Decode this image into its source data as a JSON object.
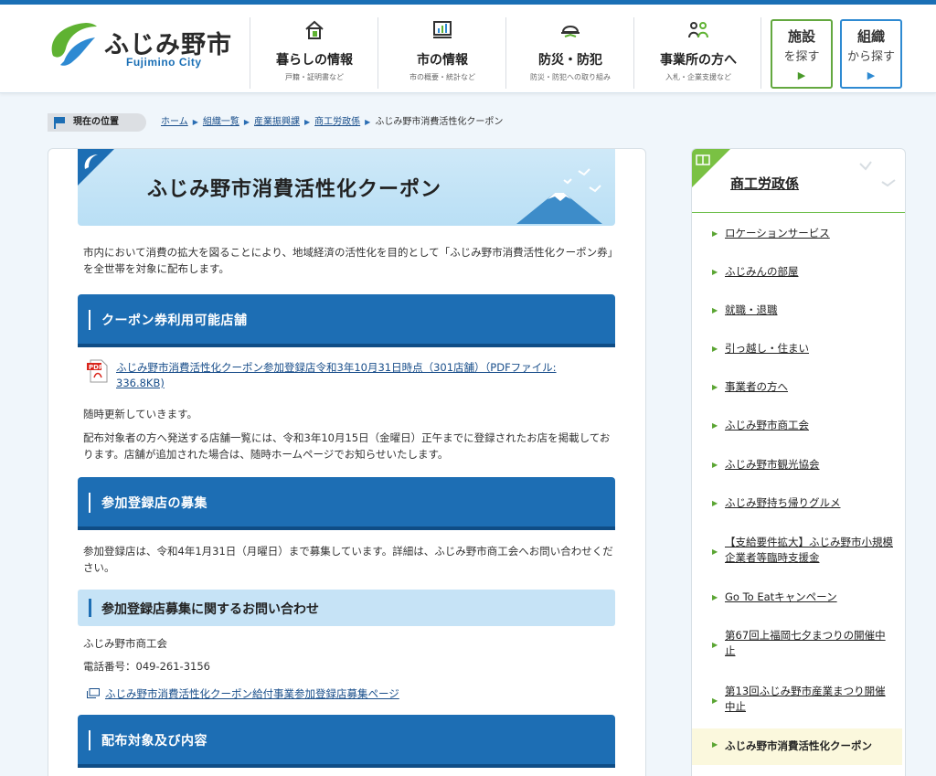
{
  "header": {
    "logo_text": "ふじみ野市",
    "logo_sub": "Fujimino City",
    "nav": [
      {
        "label": "暮らしの情報",
        "sub": "戸籍・証明書など",
        "icon": "house-icon"
      },
      {
        "label": "市の情報",
        "sub": "市の概要・統計など",
        "icon": "chart-board-icon"
      },
      {
        "label": "防災・防犯",
        "sub": "防災・防犯への取り組み",
        "icon": "helmet-icon"
      },
      {
        "label": "事業所の方へ",
        "sub": "入札・企業支援など",
        "icon": "people-icon"
      }
    ],
    "facility_btn": {
      "line1": "施設",
      "line2": "を探す",
      "arrow": "▶"
    },
    "org_btn": {
      "line1": "組織",
      "line2": "から探す",
      "arrow": "▶"
    }
  },
  "breadcrumb": {
    "label": "現在の位置",
    "items": [
      "ホーム",
      "組織一覧",
      "産業振興課",
      "商工労政係"
    ],
    "current": "ふじみ野市消費活性化クーポン",
    "sep": "▶"
  },
  "main": {
    "title": "ふじみ野市消費活性化クーポン",
    "intro": "市内において消費の拡大を図ることにより、地域経済の活性化を目的として「ふじみ野市消費活性化クーポン券」を全世帯を対象に配布します。",
    "sec1_heading": "クーポン券利用可能店舗",
    "pdf_link": "ふじみ野市消費活性化クーポン参加登録店令和3年10月31日時点（301店舗）（PDFファイル: 336.8KB)",
    "update_note": "随時更新していきます。",
    "list_note": "配布対象者の方へ発送する店舗一覧には、令和3年10月15日（金曜日）正午までに登録されたお店を掲載しております。店舗が追加された場合は、随時ホームページでお知らせいたします。",
    "sec2_heading": "参加登録店の募集",
    "recruit_text": "参加登録店は、令和4年1月31日（月曜日）まで募集しています。詳細は、ふじみ野市商工会へお問い合わせください。",
    "sec3_heading": "参加登録店募集に関するお問い合わせ",
    "contact_org": "ふじみ野市商工会",
    "contact_tel": "電話番号：049-261-3156",
    "ext_link": "ふじみ野市消費活性化クーポン給付事業参加登録店募集ページ",
    "sec4_heading": "配布対象及び内容"
  },
  "sidebar": {
    "title": "商工労政係",
    "items": [
      "ロケーションサービス",
      "ふじみんの部屋",
      "就職・退職",
      "引っ越し・住まい",
      "事業者の方へ",
      "ふじみ野市商工会",
      "ふじみ野市観光協会",
      "ふじみ野持ち帰りグルメ",
      "【支給要件拡大】ふじみ野市小規模企業者等臨時支援金",
      "Go To Eatキャンペーン",
      "第67回上福岡七夕まつりの開催中止",
      "第13回ふじみ野市産業まつり開催中止"
    ],
    "active": "ふじみ野市消費活性化クーポン"
  },
  "colors": {
    "brand_blue": "#1d6eb4",
    "brand_green": "#63a83f",
    "heading_light": "#c6e3f6"
  }
}
